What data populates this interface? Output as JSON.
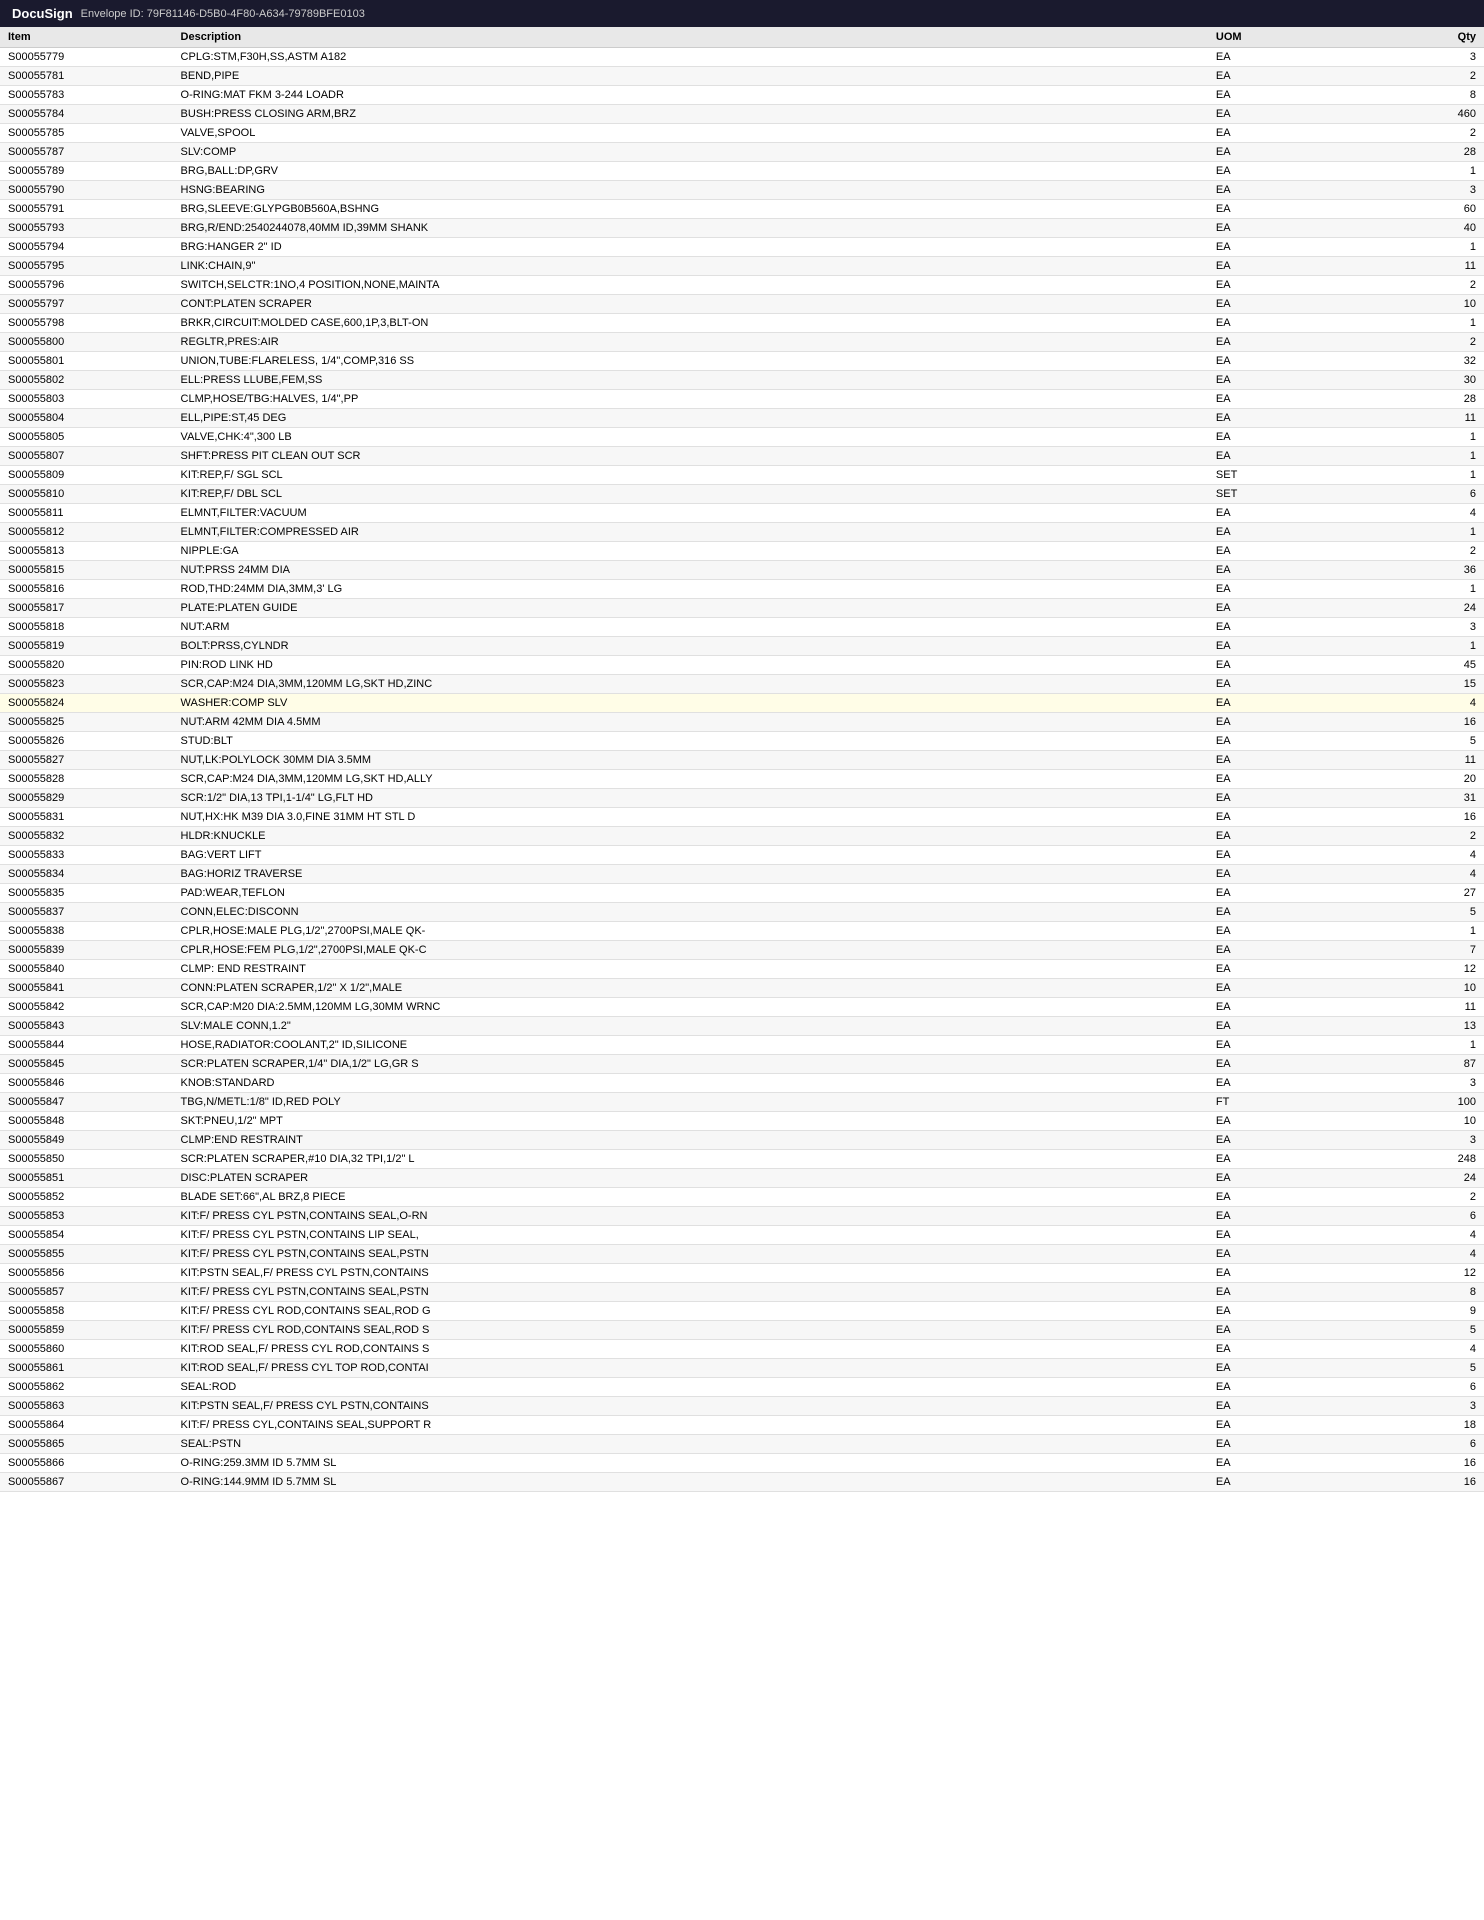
{
  "header": {
    "logo": "DocuSign",
    "title": "Envelope ID: 79F81146-D5B0-4F80-A634-79789BFE0103"
  },
  "table": {
    "columns": [
      "Item",
      "Description",
      "UOM",
      "Qty"
    ],
    "rows": [
      [
        "S00055779",
        "CPLG:STM,F30H,SS,ASTM A182",
        "EA",
        "3"
      ],
      [
        "S00055781",
        "BEND,PIPE",
        "EA",
        "2"
      ],
      [
        "S00055783",
        "O-RING:MAT FKM 3-244 LOADR",
        "EA",
        "8"
      ],
      [
        "S00055784",
        "BUSH:PRESS CLOSING ARM,BRZ",
        "EA",
        "460"
      ],
      [
        "S00055785",
        "VALVE,SPOOL",
        "EA",
        "2"
      ],
      [
        "S00055787",
        "SLV:COMP",
        "EA",
        "28"
      ],
      [
        "S00055789",
        "BRG,BALL:DP,GRV",
        "EA",
        "1"
      ],
      [
        "S00055790",
        "HSNG:BEARING",
        "EA",
        "3"
      ],
      [
        "S00055791",
        "BRG,SLEEVE:GLYPGB0B560A,BSHNG",
        "EA",
        "60"
      ],
      [
        "S00055793",
        "BRG,R/END:2540244078,40MM ID,39MM SHANK",
        "EA",
        "40"
      ],
      [
        "S00055794",
        "BRG:HANGER 2\" ID",
        "EA",
        "1"
      ],
      [
        "S00055795",
        "LINK:CHAIN,9\"",
        "EA",
        "11"
      ],
      [
        "S00055796",
        "SWITCH,SELCTR:1NO,4 POSITION,NONE,MAINTA",
        "EA",
        "2"
      ],
      [
        "S00055797",
        "CONT:PLATEN SCRAPER",
        "EA",
        "10"
      ],
      [
        "S00055798",
        "BRKR,CIRCUIT:MOLDED CASE,600,1P,3,BLT-ON",
        "EA",
        "1"
      ],
      [
        "S00055800",
        "REGLTR,PRES:AIR",
        "EA",
        "2"
      ],
      [
        "S00055801",
        "UNION,TUBE:FLARELESS, 1/4\",COMP,316 SS",
        "EA",
        "32"
      ],
      [
        "S00055802",
        "ELL:PRESS LLUBE,FEM,SS",
        "EA",
        "30"
      ],
      [
        "S00055803",
        "CLMP,HOSE/TBG:HALVES, 1/4\",PP",
        "EA",
        "28"
      ],
      [
        "S00055804",
        "ELL,PIPE:ST,45 DEG",
        "EA",
        "11"
      ],
      [
        "S00055805",
        "VALVE,CHK:4\",300 LB",
        "EA",
        "1"
      ],
      [
        "S00055807",
        "SHFT:PRESS PIT CLEAN OUT SCR",
        "EA",
        "1"
      ],
      [
        "S00055809",
        "KIT:REP,F/ SGL SCL",
        "SET",
        "1"
      ],
      [
        "S00055810",
        "KIT:REP,F/ DBL SCL",
        "SET",
        "6"
      ],
      [
        "S00055811",
        "ELMNT,FILTER:VACUUM",
        "EA",
        "4"
      ],
      [
        "S00055812",
        "ELMNT,FILTER:COMPRESSED AIR",
        "EA",
        "1"
      ],
      [
        "S00055813",
        "NIPPLE:GA",
        "EA",
        "2"
      ],
      [
        "S00055815",
        "NUT:PRSS 24MM DIA",
        "EA",
        "36"
      ],
      [
        "S00055816",
        "ROD,THD:24MM DIA,3MM,3' LG",
        "EA",
        "1"
      ],
      [
        "S00055817",
        "PLATE:PLATEN GUIDE",
        "EA",
        "24"
      ],
      [
        "S00055818",
        "NUT:ARM",
        "EA",
        "3"
      ],
      [
        "S00055819",
        "BOLT:PRSS,CYLNDR",
        "EA",
        "1"
      ],
      [
        "S00055820",
        "PIN:ROD LINK HD",
        "EA",
        "45"
      ],
      [
        "S00055823",
        "SCR,CAP:M24 DIA,3MM,120MM LG,SKT HD,ZINC",
        "EA",
        "15"
      ],
      [
        "S00055824",
        "WASHER:COMP SLV",
        "EA",
        "4"
      ],
      [
        "S00055825",
        "NUT:ARM 42MM DIA 4.5MM",
        "EA",
        "16"
      ],
      [
        "S00055826",
        "STUD:BLT",
        "EA",
        "5"
      ],
      [
        "S00055827",
        "NUT,LK:POLYLOCK 30MM DIA 3.5MM",
        "EA",
        "11"
      ],
      [
        "S00055828",
        "SCR,CAP:M24 DIA,3MM,120MM LG,SKT HD,ALLY",
        "EA",
        "20"
      ],
      [
        "S00055829",
        "SCR:1/2\" DIA,13 TPI,1-1/4\" LG,FLT HD",
        "EA",
        "31"
      ],
      [
        "S00055831",
        "NUT,HX:HK M39 DIA 3.0,FINE 31MM HT STL D",
        "EA",
        "16"
      ],
      [
        "S00055832",
        "HLDR:KNUCKLE",
        "EA",
        "2"
      ],
      [
        "S00055833",
        "BAG:VERT LIFT",
        "EA",
        "4"
      ],
      [
        "S00055834",
        "BAG:HORIZ TRAVERSE",
        "EA",
        "4"
      ],
      [
        "S00055835",
        "PAD:WEAR,TEFLON",
        "EA",
        "27"
      ],
      [
        "S00055837",
        "CONN,ELEC:DISCONN",
        "EA",
        "5"
      ],
      [
        "S00055838",
        "CPLR,HOSE:MALE PLG,1/2\",2700PSI,MALE QK-",
        "EA",
        "1"
      ],
      [
        "S00055839",
        "CPLR,HOSE:FEM PLG,1/2\",2700PSI,MALE QK-C",
        "EA",
        "7"
      ],
      [
        "S00055840",
        "CLMP: END RESTRAINT",
        "EA",
        "12"
      ],
      [
        "S00055841",
        "CONN:PLATEN SCRAPER,1/2\" X 1/2\",MALE",
        "EA",
        "10"
      ],
      [
        "S00055842",
        "SCR,CAP:M20 DIA:2.5MM,120MM LG,30MM WRNC",
        "EA",
        "11"
      ],
      [
        "S00055843",
        "SLV:MALE CONN,1.2\"",
        "EA",
        "13"
      ],
      [
        "S00055844",
        "HOSE,RADIATOR:COOLANT,2\" ID,SILICONE",
        "EA",
        "1"
      ],
      [
        "S00055845",
        "SCR:PLATEN SCRAPER,1/4\" DIA,1/2\" LG,GR S",
        "EA",
        "87"
      ],
      [
        "S00055846",
        "KNOB:STANDARD",
        "EA",
        "3"
      ],
      [
        "S00055847",
        "TBG,N/METL:1/8\" ID,RED POLY",
        "FT",
        "100"
      ],
      [
        "S00055848",
        "SKT:PNEU,1/2\" MPT",
        "EA",
        "10"
      ],
      [
        "S00055849",
        "CLMP:END RESTRAINT",
        "EA",
        "3"
      ],
      [
        "S00055850",
        "SCR:PLATEN SCRAPER,#10 DIA,32 TPI,1/2\" L",
        "EA",
        "248"
      ],
      [
        "S00055851",
        "DISC:PLATEN SCRAPER",
        "EA",
        "24"
      ],
      [
        "S00055852",
        "BLADE SET:66\",AL BRZ,8 PIECE",
        "EA",
        "2"
      ],
      [
        "S00055853",
        "KIT:F/ PRESS CYL PSTN,CONTAINS SEAL,O-RN",
        "EA",
        "6"
      ],
      [
        "S00055854",
        "KIT:F/ PRESS CYL PSTN,CONTAINS LIP SEAL,",
        "EA",
        "4"
      ],
      [
        "S00055855",
        "KIT:F/ PRESS CYL PSTN,CONTAINS SEAL,PSTN",
        "EA",
        "4"
      ],
      [
        "S00055856",
        "KIT:PSTN SEAL,F/ PRESS CYL PSTN,CONTAINS",
        "EA",
        "12"
      ],
      [
        "S00055857",
        "KIT:F/ PRESS CYL PSTN,CONTAINS SEAL,PSTN",
        "EA",
        "8"
      ],
      [
        "S00055858",
        "KIT:F/ PRESS CYL ROD,CONTAINS SEAL,ROD G",
        "EA",
        "9"
      ],
      [
        "S00055859",
        "KIT:F/ PRESS CYL ROD,CONTAINS SEAL,ROD S",
        "EA",
        "5"
      ],
      [
        "S00055860",
        "KIT:ROD SEAL,F/ PRESS CYL ROD,CONTAINS S",
        "EA",
        "4"
      ],
      [
        "S00055861",
        "KIT:ROD SEAL,F/ PRESS CYL TOP ROD,CONTAI",
        "EA",
        "5"
      ],
      [
        "S00055862",
        "SEAL:ROD",
        "EA",
        "6"
      ],
      [
        "S00055863",
        "KIT:PSTN SEAL,F/ PRESS CYL PSTN,CONTAINS",
        "EA",
        "3"
      ],
      [
        "S00055864",
        "KIT:F/ PRESS CYL,CONTAINS SEAL,SUPPORT R",
        "EA",
        "18"
      ],
      [
        "S00055865",
        "SEAL:PSTN",
        "EA",
        "6"
      ],
      [
        "S00055866",
        "O-RING:259.3MM ID 5.7MM SL",
        "EA",
        "16"
      ],
      [
        "S00055867",
        "O-RING:144.9MM ID 5.7MM SL",
        "EA",
        "16"
      ]
    ],
    "highlighted_row": "S00055824"
  }
}
